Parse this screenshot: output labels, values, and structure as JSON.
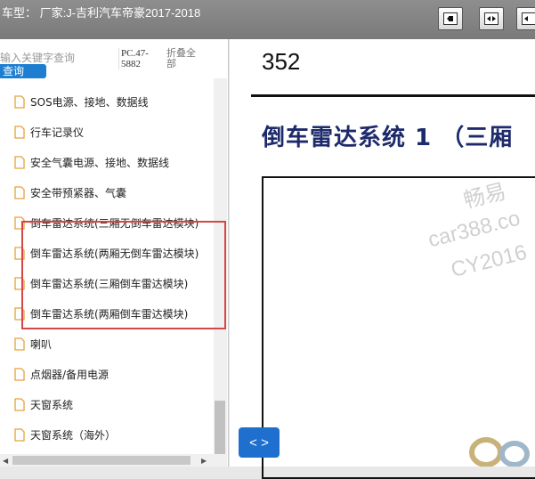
{
  "header": {
    "title": "车型：  厂家:J-吉利汽车帝豪2017-2018",
    "buttons": [
      {
        "name": "single-page-icon"
      },
      {
        "name": "double-page-icon"
      },
      {
        "name": "fit-page-icon"
      }
    ]
  },
  "sidebar": {
    "search_placeholder": "输入关键字查询",
    "query_label": "查询",
    "pc_number": "PC.47-5882",
    "collapse_label": "折叠全部",
    "items": [
      {
        "label": "SOS电源、接地、数据线"
      },
      {
        "label": "行车记录仪"
      },
      {
        "label": "安全气囊电源、接地、数据线"
      },
      {
        "label": "安全带预紧器、气囊"
      },
      {
        "label": "倒车雷达系统(三厢无倒车雷达模块)"
      },
      {
        "label": "倒车雷达系统(两厢无倒车雷达模块)"
      },
      {
        "label": "倒车雷达系统(三厢倒车雷达模块)"
      },
      {
        "label": "倒车雷达系统(两厢倒车雷达模块)"
      },
      {
        "label": "喇叭"
      },
      {
        "label": "点烟器/备用电源"
      },
      {
        "label": "天窗系统"
      },
      {
        "label": "天窗系统（海外）"
      }
    ]
  },
  "document": {
    "page_number": "352",
    "title": "倒车雷达系统 1 （三厢",
    "watermark_1": "畅易",
    "watermark_2": "car388.co",
    "watermark_3": "CY2016",
    "nav_label": "< >"
  }
}
